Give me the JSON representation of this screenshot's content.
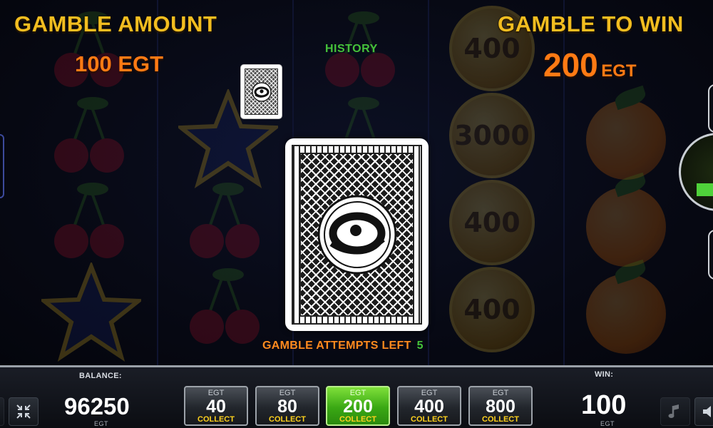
{
  "header": {
    "gamble_amount_label": "GAMBLE AMOUNT",
    "gamble_amount_value": "100",
    "gamble_amount_currency": "EGT",
    "gamble_to_win_label": "GAMBLE TO WIN",
    "gamble_to_win_value": "200",
    "gamble_to_win_currency": "EGT",
    "history_label": "HISTORY"
  },
  "gamble": {
    "attempts_label": "GAMBLE ATTEMPTS LEFT",
    "attempts_value": "5"
  },
  "background_symbols": {
    "coins": [
      "400",
      "3000",
      "400",
      "400"
    ]
  },
  "bottom_bar": {
    "balance_label": "BALANCE:",
    "balance_value": "96250",
    "balance_currency": "EGT",
    "win_label": "WIN:",
    "win_value": "100",
    "win_currency": "EGT",
    "collect_buttons": [
      {
        "currency": "EGT",
        "value": "40",
        "label": "COLLECT"
      },
      {
        "currency": "EGT",
        "value": "80",
        "label": "COLLECT"
      },
      {
        "currency": "EGT",
        "value": "200",
        "label": "COLLECT",
        "active": true
      },
      {
        "currency": "EGT",
        "value": "400",
        "label": "COLLECT"
      },
      {
        "currency": "EGT",
        "value": "800",
        "label": "COLLECT"
      }
    ]
  },
  "colors": {
    "header_gold": "#f2bd20",
    "amount_orange": "#ff7a14",
    "history_green": "#45c23a",
    "active_green": "#3aa814",
    "collect_yellow": "#ffd21e"
  },
  "icons": {
    "fullscreen": "collapse-arrows-icon",
    "music": "music-note-icon",
    "sound": "speaker-icon",
    "card_logo": "egt-swirl-logo-icon"
  }
}
